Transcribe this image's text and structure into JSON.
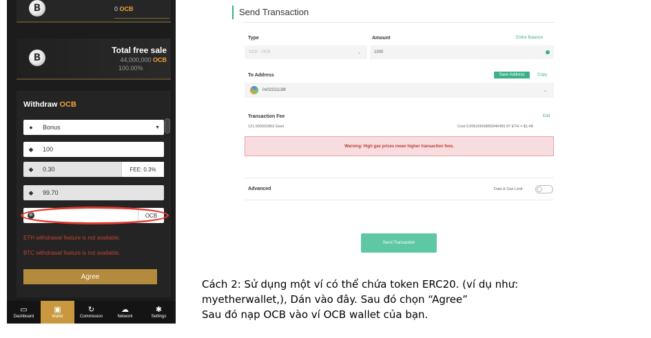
{
  "phone": {
    "top_card": {
      "balance_value": "0",
      "balance_unit": "OCB",
      "coin_glyph": "B"
    },
    "sale_card": {
      "title": "Total free sale",
      "amount": "44,000,000",
      "amount_unit": "OCB",
      "percent": "100.00%",
      "coin_glyph": "B"
    },
    "withdraw": {
      "title_prefix": "Withdraw",
      "title_token": "OCB",
      "type_icon": "map-pin-icon",
      "type_value": "Bonus",
      "amount_value": "100",
      "fee_value": "0.30",
      "fee_label": "FEE: 0.3%",
      "receive_value": "99.70",
      "address_unit": "OCB",
      "address_icon": "bitcoin-icon",
      "warning_eth": "ETH withdrawal feature is not available.",
      "warning_btc": "BTC withdrawal feature is not available.",
      "agree_label": "Agree"
    },
    "tabs": [
      {
        "label": "Dashboard",
        "icon": "monitor-icon",
        "glyph": "▭",
        "active": false
      },
      {
        "label": "Wallet",
        "icon": "wallet-icon",
        "glyph": "▣",
        "active": true
      },
      {
        "label": "Commission",
        "icon": "history-icon",
        "glyph": "↻",
        "active": false
      },
      {
        "label": "Network",
        "icon": "cloud-icon",
        "glyph": "☁",
        "active": false
      },
      {
        "label": "Settings",
        "icon": "gear-icon",
        "glyph": "✱",
        "active": false
      }
    ],
    "colors": {
      "gold": "#f0a23a",
      "active_tab": "#c9973f",
      "agree": "#b48a3c",
      "warning": "#c0442f",
      "highlight": "#e03a2f"
    }
  },
  "form": {
    "title": "Send Transaction",
    "type_label": "Type",
    "type_value": "OCB - OCB",
    "amount_label": "Amount",
    "entire_balance": "Entire Balance",
    "amount_value": "1000",
    "to_address_label": "To Address",
    "save_address": "Save Address",
    "copy": "Copy",
    "address_value": "0x02311138f",
    "fee_label": "Transaction Fee",
    "edit": "Edit",
    "gwei": "121.500001853 Gwei",
    "cost": "Cost 0.00620609855946455 87 ETH = $1.48",
    "alert": "Warning: High gas prices mean higher transaction fees.",
    "advanced": "Advanced",
    "data_gas": "Data & Gas Limit",
    "send_button": "Send Transaction",
    "colors": {
      "accent": "#3cb08a",
      "button": "#5ec8a4",
      "alert_bg": "#f8dde0"
    }
  },
  "caption": {
    "line1": "Cách 2: Sử dụng một ví có thể chứa token ERC20. (ví dụ như:",
    "line2": "myetherwallet,), Dán vào đây. Sau đó chọn “Agree”",
    "line3": "Sau đó nạp OCB vào ví OCB wallet của bạn."
  }
}
